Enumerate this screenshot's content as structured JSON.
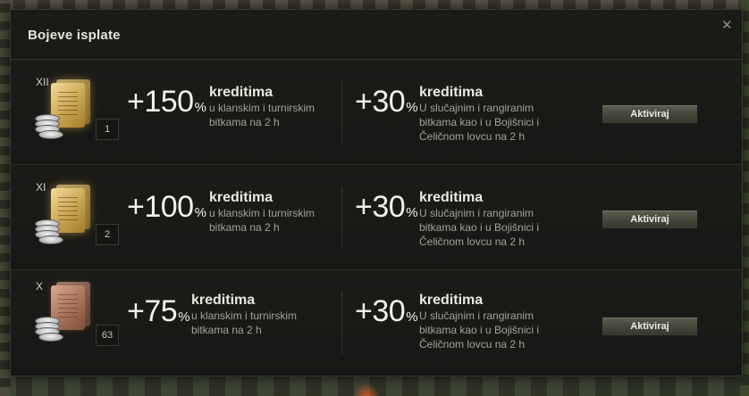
{
  "window": {
    "title": "Bojeve isplate",
    "close_icon": "close-icon"
  },
  "offers": [
    {
      "tier": "XII",
      "count": "1",
      "icon_type": "gold",
      "left_value": "+150",
      "left_percent": "%",
      "left_unit": "kreditima",
      "left_desc": "u klanskim i turnirskim bitkama na 2 h",
      "right_value": "+30",
      "right_percent": "%",
      "right_unit": "kreditima",
      "right_desc": "U slučajnim i rangiranim bitkama kao i u Bojišnici i Čeličnom lovcu na 2 h",
      "button": "Aktiviraj"
    },
    {
      "tier": "XI",
      "count": "2",
      "icon_type": "gold",
      "left_value": "+100",
      "left_percent": "%",
      "left_unit": "kreditima",
      "left_desc": "u klanskim i turnirskim bitkama na 2 h",
      "right_value": "+30",
      "right_percent": "%",
      "right_unit": "kreditima",
      "right_desc": "U slučajnim i rangiranim bitkama kao i u Bojišnici i Čeličnom lovcu na 2 h",
      "button": "Aktiviraj"
    },
    {
      "tier": "X",
      "count": "63",
      "icon_type": "bronze",
      "left_value": "+75",
      "left_percent": "%",
      "left_unit": "kreditima",
      "left_desc": "u klanskim i turnirskim bitkama na 2 h",
      "right_value": "+30",
      "right_percent": "%",
      "right_unit": "kreditima",
      "right_desc": "U slučajnim i rangiranim bitkama kao i u Bojišnici i Čeličnom lovcu na 2 h",
      "button": "Aktiviraj"
    }
  ]
}
